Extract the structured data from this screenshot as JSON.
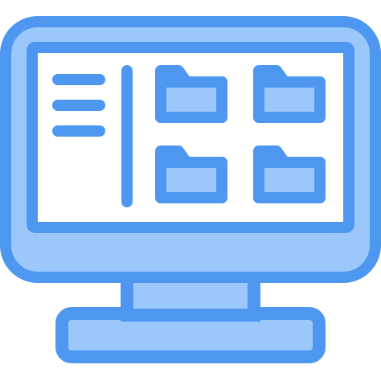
{
  "icon": {
    "name": "desktop-file-manager-icon",
    "colors": {
      "stroke": "#4d97f0",
      "fill_light": "#9cc7fb",
      "fill_body": "#9cc7fb",
      "screen": "#ffffff"
    },
    "content": {
      "menu_lines": 3,
      "folders": 4
    }
  }
}
